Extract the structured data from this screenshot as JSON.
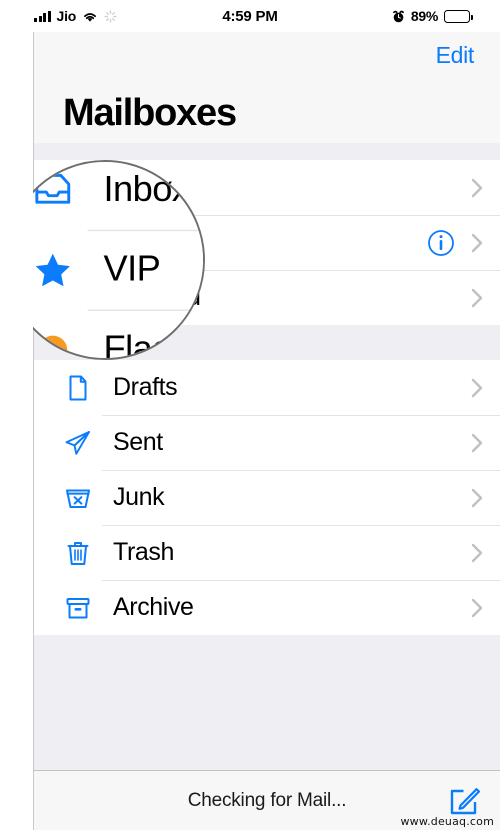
{
  "status_bar": {
    "carrier": "Jio",
    "signal_icon": "signal-bars-icon",
    "wifi_icon": "wifi-icon",
    "sync_icon": "sync-spinner-icon",
    "time": "4:59 PM",
    "alarm_icon": "alarm-clock-icon",
    "battery_percent": "89%",
    "battery_icon": "battery-icon"
  },
  "nav": {
    "edit_label": "Edit",
    "title": "Mailboxes"
  },
  "colors": {
    "accent_blue": "#007AFF",
    "link_blue": "#0b7cfb",
    "flag_orange": "#f59b21",
    "group_background": "#eeeef3",
    "row_background": "#ffffff",
    "separator": "#e4e4e6",
    "chevron_gray": "#c0c0c4"
  },
  "mailboxes": {
    "section_one": [
      {
        "label": "Inbox",
        "icon": "inbox-tray-icon",
        "has_info": false,
        "chevron": "chevron-right-icon"
      },
      {
        "label": "VIP",
        "icon": "star-icon",
        "has_info": true,
        "info_icon": "info-circle-icon",
        "chevron": "chevron-right-icon"
      },
      {
        "label": "Flagged",
        "icon": "flag-dot-icon",
        "has_info": false,
        "chevron": "chevron-right-icon"
      }
    ],
    "section_two": [
      {
        "label": "Drafts",
        "icon": "document-icon",
        "chevron": "chevron-right-icon"
      },
      {
        "label": "Sent",
        "icon": "paper-plane-icon",
        "chevron": "chevron-right-icon"
      },
      {
        "label": "Junk",
        "icon": "junk-bin-x-icon",
        "chevron": "chevron-right-icon"
      },
      {
        "label": "Trash",
        "icon": "trash-can-icon",
        "chevron": "chevron-right-icon"
      },
      {
        "label": "Archive",
        "icon": "archive-box-icon",
        "chevron": "chevron-right-icon"
      }
    ]
  },
  "magnifier": {
    "rows": [
      {
        "label": "Inbox",
        "icon": "inbox-tray-icon"
      },
      {
        "label": "VIP",
        "icon": "star-icon"
      },
      {
        "label": "Flagged",
        "icon": "flag-dot-icon"
      }
    ]
  },
  "toolbar": {
    "status_text": "Checking for Mail...",
    "compose_icon": "compose-pencil-icon"
  },
  "watermark": {
    "text": "www.deuaq.com"
  }
}
